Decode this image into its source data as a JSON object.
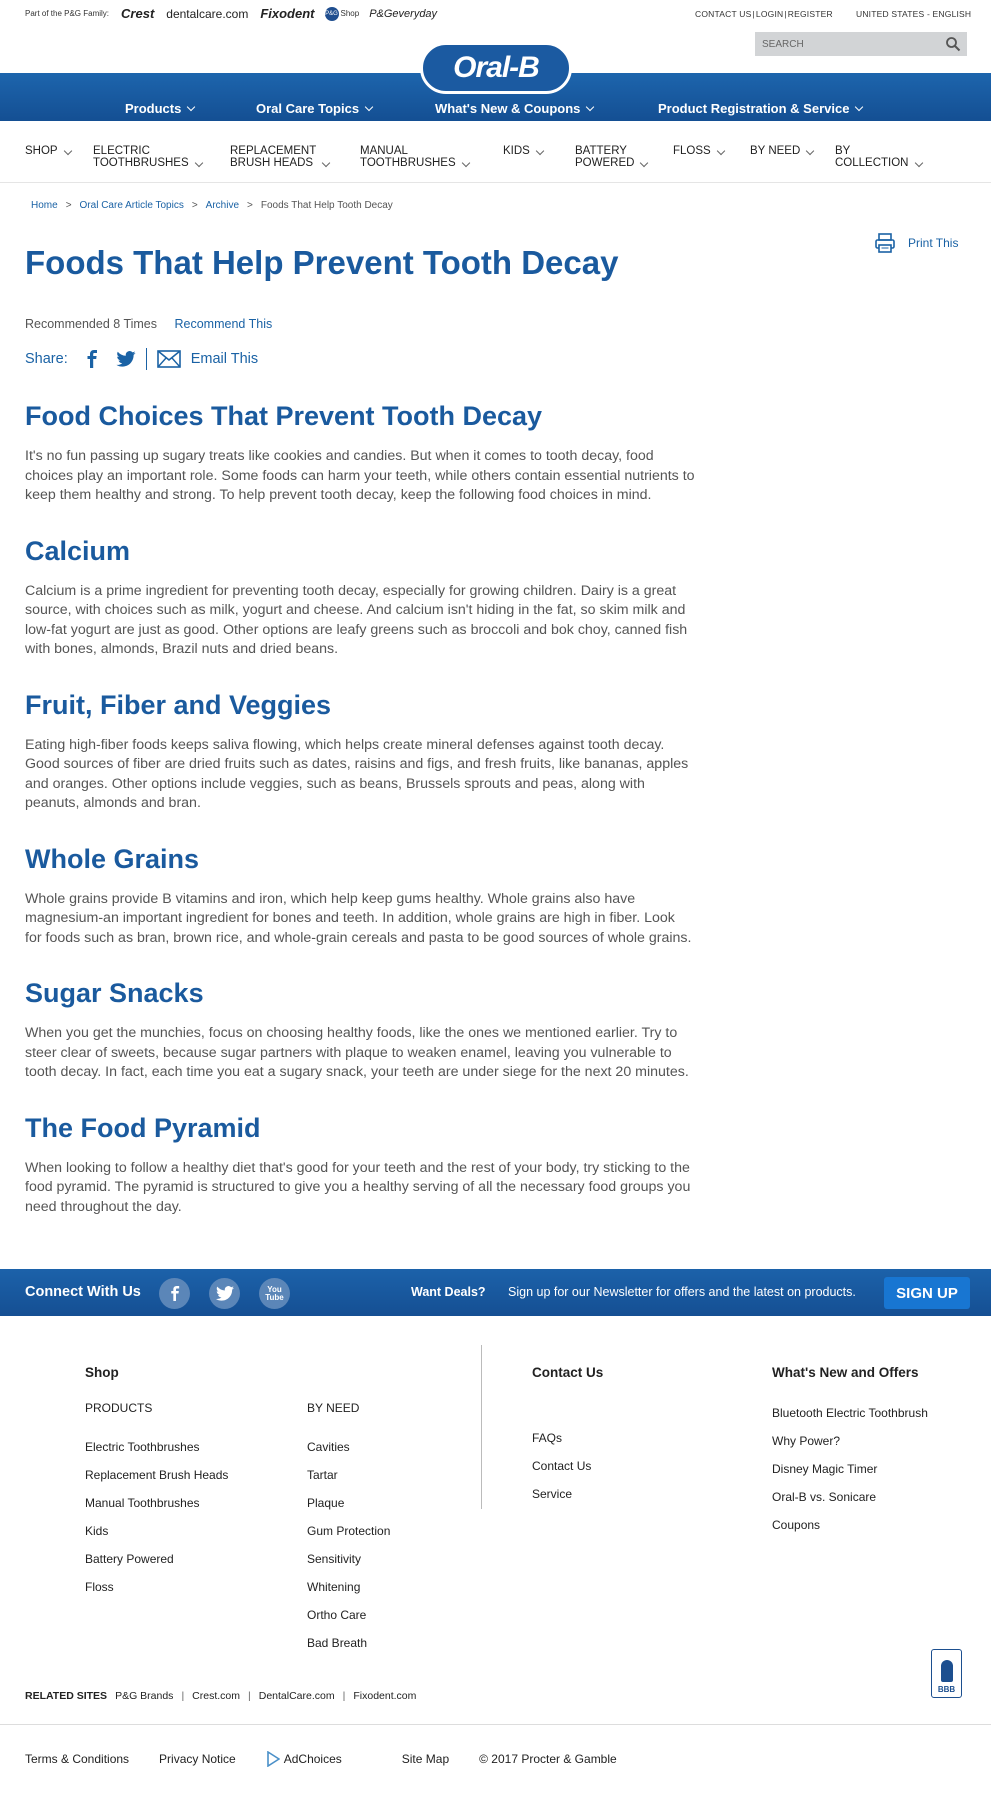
{
  "family": {
    "label": "Part of the P&G Family:",
    "brands": [
      "Crest",
      "dentalcare.com",
      "Fixodent",
      "Shop",
      "P&Geveryday"
    ],
    "pg_badge": "P&G"
  },
  "utility": {
    "contact": "CONTACT US",
    "login": "LOGIN",
    "register": "REGISTER",
    "region": "UNITED STATES - ENGLISH",
    "separator": "|"
  },
  "search": {
    "placeholder": "SEARCH"
  },
  "logo": {
    "text": "Oral-B"
  },
  "main_nav": [
    "Products",
    "Oral Care Topics",
    "What's New & Coupons",
    "Product Registration & Service"
  ],
  "category_nav": [
    {
      "line1": "SHOP",
      "line2": ""
    },
    {
      "line1": "ELECTRIC",
      "line2": "TOOTHBRUSHES"
    },
    {
      "line1": "REPLACEMENT",
      "line2": "BRUSH HEADS"
    },
    {
      "line1": "MANUAL",
      "line2": "TOOTHBRUSHES"
    },
    {
      "line1": "KIDS",
      "line2": ""
    },
    {
      "line1": "BATTERY",
      "line2": "POWERED"
    },
    {
      "line1": "FLOSS",
      "line2": ""
    },
    {
      "line1": "BY NEED",
      "line2": ""
    },
    {
      "line1": "BY",
      "line2": "COLLECTION"
    }
  ],
  "breadcrumb": {
    "items": [
      "Home",
      "Oral Care Article Topics",
      "Archive"
    ],
    "current": "Foods That Help Tooth Decay",
    "separator": ">"
  },
  "print_label": "Print This",
  "title": "Foods That Help Prevent Tooth Decay",
  "recommend": {
    "count_text": "Recommended 8 Times",
    "action": "Recommend This"
  },
  "share": {
    "label": "Share:",
    "email": "Email This",
    "icons": [
      "facebook-icon",
      "twitter-icon",
      "email-icon"
    ]
  },
  "article": [
    {
      "heading": "Food Choices That Prevent Tooth Decay",
      "body": "It's no fun passing up sugary treats like cookies and candies. But when it comes to tooth decay, food choices play an important role. Some foods can harm your teeth, while others contain essential nutrients to keep them healthy and strong. To help prevent tooth decay, keep the following food choices in mind."
    },
    {
      "heading": "Calcium",
      "body": "Calcium is a prime ingredient for preventing tooth decay, especially for growing children. Dairy is a great source, with choices such as milk, yogurt and cheese. And calcium isn't hiding in the fat, so skim milk and low-fat yogurt are just as good. Other options are leafy greens such as broccoli and bok choy, canned fish with bones, almonds, Brazil nuts and dried beans."
    },
    {
      "heading": "Fruit, Fiber and Veggies",
      "body": "Eating high-fiber foods keeps saliva flowing, which helps create mineral defenses against tooth decay. Good sources of fiber are dried fruits such as dates, raisins and figs, and fresh fruits, like bananas, apples and oranges. Other options include veggies, such as beans, Brussels sprouts and peas, along with peanuts, almonds and bran."
    },
    {
      "heading": "Whole Grains",
      "body": "Whole grains provide B vitamins and iron, which help keep gums healthy. Whole grains also have magnesium-an important ingredient for bones and teeth. In addition, whole grains are high in fiber. Look for foods such as bran, brown rice, and whole-grain cereals and pasta to be good sources of whole grains."
    },
    {
      "heading": "Sugar Snacks",
      "body": "When you get the munchies, focus on choosing healthy foods, like the ones we mentioned earlier. Try to steer clear of sweets, because sugar partners with plaque to weaken enamel, leaving you vulnerable to tooth decay. In fact, each time you eat a sugary snack, your teeth are under siege for the next 20 minutes."
    },
    {
      "heading": "The Food Pyramid",
      "body": "When looking to follow a healthy diet that's good for your teeth and the rest of your body, try sticking to the food pyramid. The pyramid is structured to give you a healthy serving of all the necessary food groups you need throughout the day."
    }
  ],
  "connect": {
    "label": "Connect With Us",
    "social": [
      "facebook-icon",
      "twitter-icon",
      "youtube-icon"
    ],
    "youtube_text": "You Tube",
    "deals": "Want Deals?",
    "newsletter": "Sign up for our Newsletter for offers and the latest on products.",
    "signup": "SIGN UP"
  },
  "footer": {
    "shop_heading": "Shop",
    "products_heading": "PRODUCTS",
    "products": [
      "Electric Toothbrushes",
      "Replacement Brush Heads",
      "Manual Toothbrushes",
      "Kids",
      "Battery Powered",
      "Floss"
    ],
    "byneed_heading": "BY NEED",
    "byneed": [
      "Cavities",
      "Tartar",
      "Plaque",
      "Gum Protection",
      "Sensitivity",
      "Whitening",
      "Ortho Care",
      "Bad Breath"
    ],
    "contact_heading": "Contact Us",
    "contact": [
      "FAQs",
      "Contact Us",
      "Service"
    ],
    "whatsnew_heading": "What's New and Offers",
    "whatsnew": [
      "Bluetooth Electric Toothbrush",
      "Why Power?",
      "Disney Magic Timer",
      "Oral-B vs. Sonicare",
      "Coupons"
    ]
  },
  "related": {
    "label": "RELATED SITES",
    "sites": [
      "P&G Brands",
      "Crest.com",
      "DentalCare.com",
      "Fixodent.com"
    ],
    "separator": "|"
  },
  "bbb": {
    "text": "BBB"
  },
  "legal": [
    "Terms & Conditions",
    "Privacy Notice",
    "AdChoices",
    "Site Map",
    "© 2017 Procter & Gamble"
  ],
  "colors": {
    "brand_blue": "#1a5a9e",
    "link_blue": "#1a62a5",
    "nav_blue": "#1d65ad",
    "signup": "#1876d2"
  }
}
